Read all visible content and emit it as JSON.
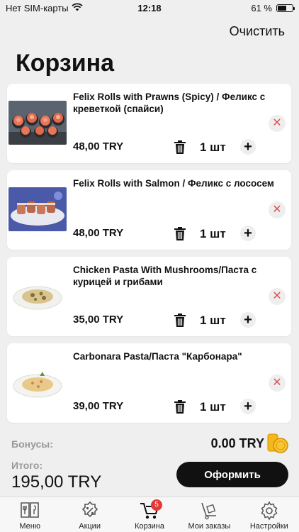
{
  "status_bar": {
    "carrier": "Нет SIM-карты",
    "time": "12:18",
    "battery_label": "61 %",
    "battery_level": 0.61,
    "wifi_icon": "wifi-icon",
    "battery_icon": "battery-icon"
  },
  "header": {
    "clear_label": "Очистить",
    "title": "Корзина"
  },
  "cart": {
    "items": [
      {
        "name": "Felix Rolls with Prawns (Spicy) / Феликс с креветкой (спайси)",
        "price": "48,00 TRY",
        "quantity": "1 шт",
        "image": "sushi-rolls-prawns"
      },
      {
        "name": "Felix Rolls with Salmon / Феликс с лососем",
        "price": "48,00 TRY",
        "quantity": "1 шт",
        "image": "sushi-rolls-salmon"
      },
      {
        "name": "Chicken Pasta With Mushrooms/Паста с курицей и грибами",
        "price": "35,00 TRY",
        "quantity": "1 шт",
        "image": "chicken-pasta"
      },
      {
        "name": "Carbonara Pasta/Паста \"Карбонара\"",
        "price": "39,00 TRY",
        "quantity": "1 шт",
        "image": "carbonara-pasta"
      }
    ],
    "plus_symbol": "+",
    "remove_symbol": "✕"
  },
  "summary": {
    "bonus_label": "Бонусы:",
    "bonus_value": "0.00 TRY",
    "total_label": "Итого:",
    "total_value": "195,00 TRY",
    "checkout_label": "Оформить"
  },
  "tabbar": {
    "tabs": [
      {
        "label": "Меню",
        "icon": "menu-book-icon",
        "active": false
      },
      {
        "label": "Акции",
        "icon": "discount-badge-icon",
        "active": false
      },
      {
        "label": "Корзина",
        "icon": "cart-icon",
        "active": true,
        "badge": "5"
      },
      {
        "label": "Мои заказы",
        "icon": "orders-dolly-icon",
        "active": false
      },
      {
        "label": "Настройки",
        "icon": "gear-icon",
        "active": false
      }
    ]
  },
  "colors": {
    "background": "#efefef",
    "accent": "#111111",
    "remove_red": "#e05252",
    "badge_red": "#e53935",
    "coin_gold": "#f5b81c"
  }
}
